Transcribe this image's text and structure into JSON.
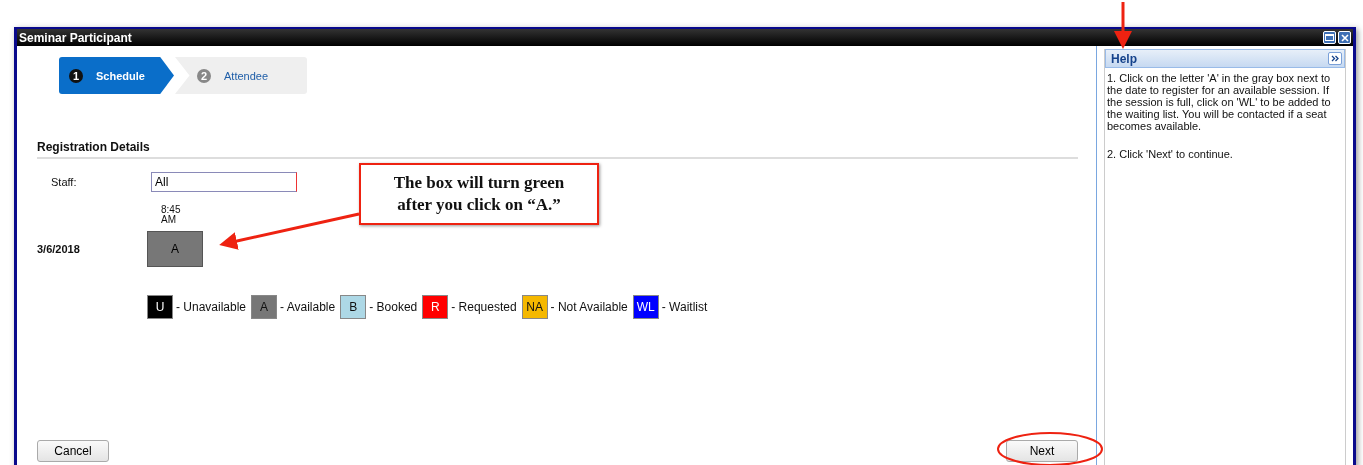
{
  "window": {
    "title": "Seminar Participant"
  },
  "steps": [
    {
      "number": "1",
      "label": "Schedule",
      "selected": true
    },
    {
      "number": "2",
      "label": "Attendee",
      "selected": false
    }
  ],
  "section": {
    "title": "Registration Details"
  },
  "staff": {
    "label": "Staff:",
    "value": "All"
  },
  "schedule": {
    "time": "8:45 AM",
    "rows": [
      {
        "date": "3/6/2018",
        "slot": "A",
        "color": "#777777"
      }
    ]
  },
  "legend": [
    {
      "code": "U",
      "label": "- Unavailable",
      "color": "#000000"
    },
    {
      "code": "A",
      "label": "- Available",
      "color": "#777777"
    },
    {
      "code": "B",
      "label": "- Booked",
      "color": "#add8e6"
    },
    {
      "code": "R",
      "label": "- Requested",
      "color": "#ff0000"
    },
    {
      "code": "NA",
      "label": "- Not Available",
      "color": "#f5b800"
    },
    {
      "code": "WL",
      "label": "- Waitlist",
      "color": "#0000ff"
    }
  ],
  "buttons": {
    "cancel": "Cancel",
    "next": "Next"
  },
  "help": {
    "title": "Help",
    "paragraphs": [
      "1. Click on the letter 'A' in the gray box next to the date to register for an available session. If the session is full, click on 'WL' to be added to the waiting list. You will be contacted if a seat becomes available.",
      "2. Click 'Next' to continue."
    ]
  },
  "callout": {
    "text": "The box will turn green after you click on “A.”"
  }
}
